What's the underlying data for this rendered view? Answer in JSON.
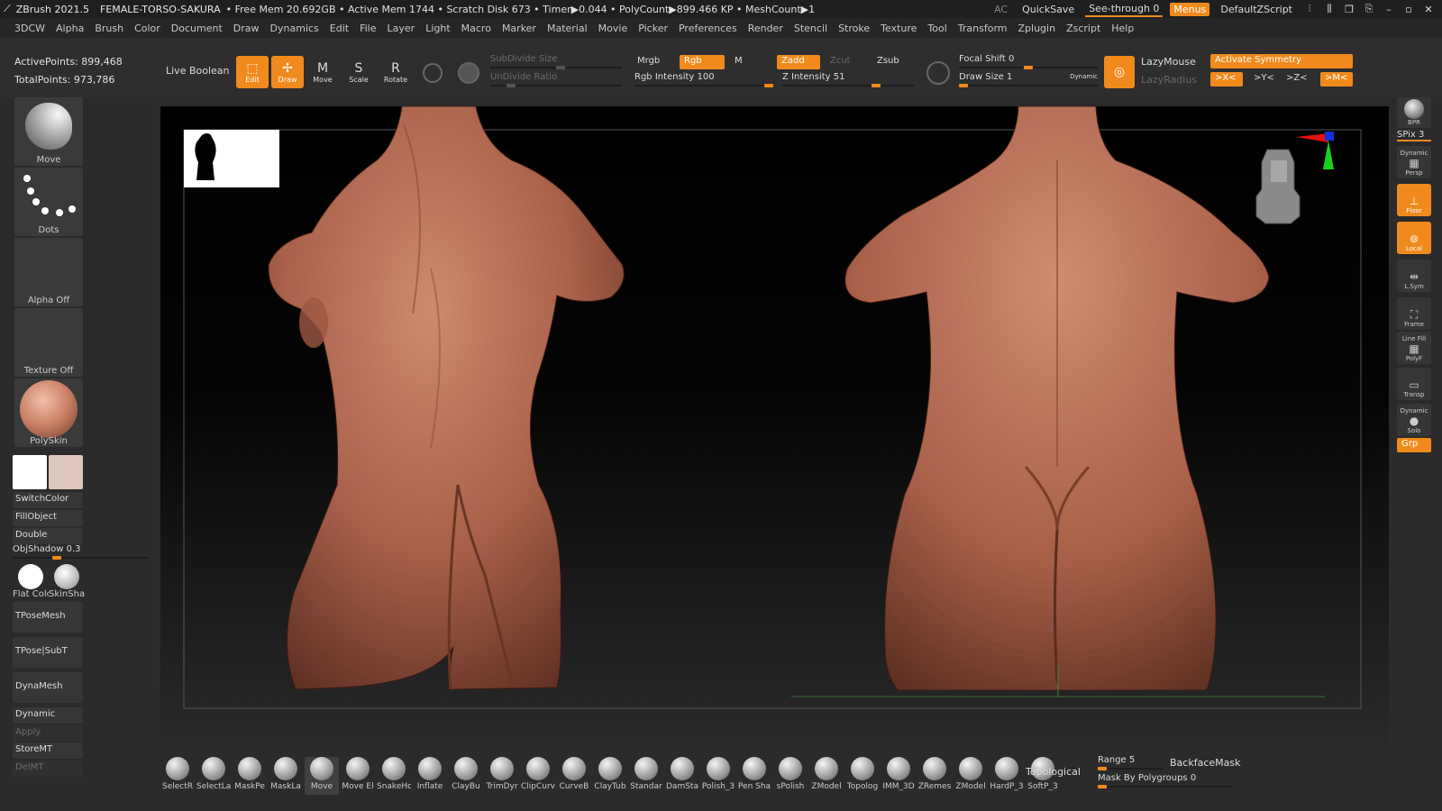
{
  "titlebar": {
    "app": "ZBrush 2021.5",
    "file": "FEMALE-TORSO-SAKURA",
    "stats": "• Free Mem 20.692GB • Active Mem 1744 • Scratch Disk 673 • Timer▶0.044 • PolyCount▶899.466 KP • MeshCount▶1",
    "ac": "AC",
    "quicksave": "QuickSave",
    "seethrough": "See-through",
    "seethrough_value": "0",
    "menus": "Menus",
    "script": "DefaultZScript"
  },
  "menubar": [
    "3DCW",
    "Alpha",
    "Brush",
    "Color",
    "Document",
    "Draw",
    "Dynamics",
    "Edit",
    "File",
    "Layer",
    "Light",
    "Macro",
    "Marker",
    "Material",
    "Movie",
    "Picker",
    "Preferences",
    "Render",
    "Stencil",
    "Stroke",
    "Texture",
    "Tool",
    "Transform",
    "Zplugin",
    "Zscript",
    "Help"
  ],
  "toolbar": {
    "active_points": "ActivePoints: 899,468",
    "total_points": "TotalPoints: 973,786",
    "live_boolean": "Live Boolean",
    "edit": "Edit",
    "draw": "Draw",
    "move": "Move",
    "scale": "Scale",
    "rotate": "Rotate",
    "subdivide_size": "SubDivide Size",
    "undivide_ratio": "UnDivide Ratio",
    "mrgb": "Mrgb",
    "rgb": "Rgb",
    "m": "M",
    "rgb_intensity": "Rgb Intensity 100",
    "zadd": "Zadd",
    "zcut": "Zcut",
    "zsub": "Zsub",
    "z_intensity": "Z Intensity 51",
    "focal_shift": "Focal Shift 0",
    "draw_size": "Draw Size 1",
    "dynamic": "Dynamic",
    "lazymouse": "LazyMouse",
    "lazyradius": "LazyRadius",
    "activate_symmetry": "Activate Symmetry",
    "sym_x": ">X<",
    "sym_y": ">Y<",
    "sym_z": ">Z<",
    "sym_m": ">M<"
  },
  "leftshelf": {
    "brush": "Move",
    "stroke": "Dots",
    "alpha": "Alpha Off",
    "texture": "Texture Off",
    "material": "PolySkin",
    "switchcolor": "SwitchColor",
    "fillobject": "FillObject",
    "double": "Double",
    "objshadow": "ObjShadow 0.3",
    "flatcolor": "Flat Colc",
    "skinshade": "SkinSha",
    "tposemesh": "TPoseMesh",
    "tposesubt": "TPose|SubT",
    "dynamesh": "DynaMesh",
    "dynamic": "Dynamic",
    "apply": "Apply",
    "storemt": "StoreMT",
    "delmt": "DelMT"
  },
  "rightshelf": {
    "bpr": "BPR",
    "spix": "SPix 3",
    "persp": "Persp",
    "dynamic_label": "Dynamic",
    "floor": "Floor",
    "local": "Local",
    "lsym": "L.Sym",
    "frame": "Frame",
    "linefill": "Line Fill",
    "polyf": "PolyF",
    "transp": "Transp",
    "solo_dynamic": "Dynamic",
    "solo": "Solo",
    "grp": "Grp"
  },
  "bottomshelf": {
    "brushes": [
      "SelectR",
      "SelectLa",
      "MaskPe",
      "MaskLa",
      "Move",
      "Move El",
      "SnakeHo",
      "Inflate",
      "ClayBu",
      "TrimDyr",
      "ClipCurv",
      "CurveB",
      "ClayTub",
      "Standar",
      "DamSta",
      "Polish_3",
      "Pen Sha",
      "sPolish",
      "ZModel",
      "Topolog",
      "IMM_3D",
      "ZRemes",
      "ZModel",
      "HardP_3",
      "SoftP_3"
    ],
    "topological": "Topological",
    "range": "Range 5",
    "backfacemask": "BackfaceMask",
    "mask_by_polygroups": "Mask By Polygroups 0"
  },
  "colors": {
    "accent": "#f08a1c",
    "skin": "#b46a50",
    "background": "#2b2b2b"
  }
}
